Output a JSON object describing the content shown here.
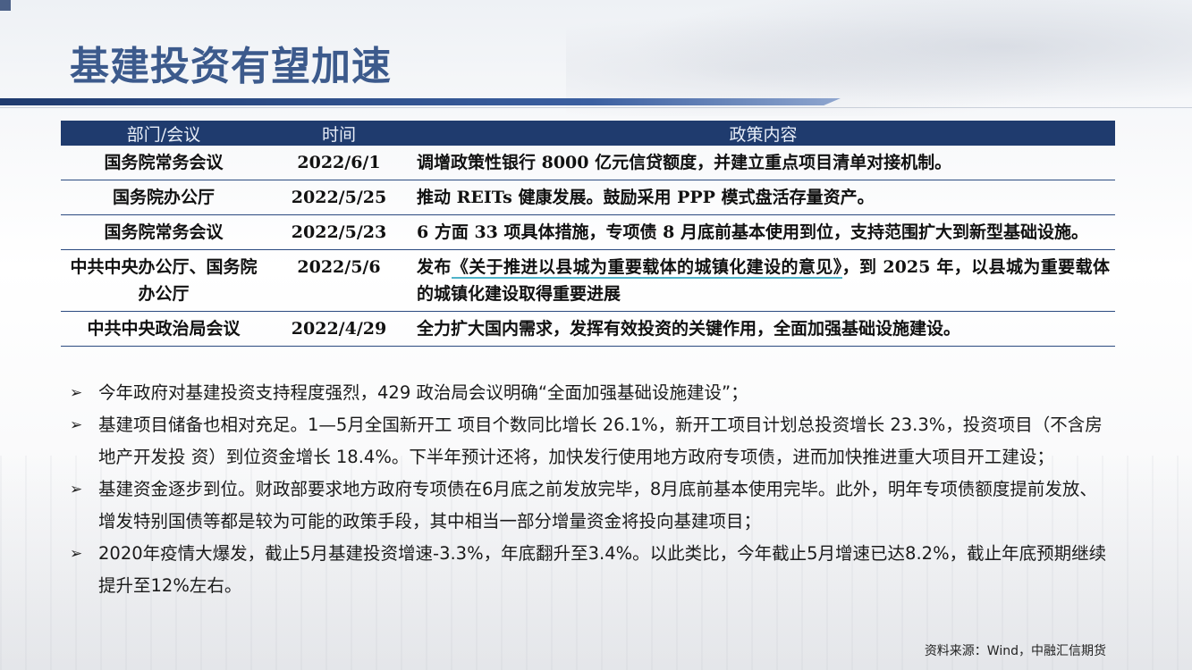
{
  "slide": {
    "title": "基建投资有望加速",
    "table": {
      "headers": [
        "部门/会议",
        "时间",
        "政策内容"
      ],
      "rows": [
        {
          "dept": "国务院常务会议",
          "date": "2022/6/1",
          "content_parts": [
            "调增政策性银行 8000 亿元信贷额度，并建立重点项目清单对接机制。"
          ]
        },
        {
          "dept": "国务院办公厅",
          "date": "2022/5/25",
          "content_parts": [
            "推动 REITs 健康发展。鼓励采用 PPP 模式盘活存量资产。"
          ]
        },
        {
          "dept": "国务院常务会议",
          "date": "2022/5/23",
          "content_parts": [
            "6 方面 33 项具体措施，专项债 8 月底前基本使用到位，支持范围扩大到新型基础设施。"
          ]
        },
        {
          "dept": "中共中央办公厅、国务院办公厅",
          "date": "2022/5/6",
          "content_parts": [
            "发布",
            "《关于推进以县城为重要载体的城镇化建设的意见》",
            "，到 2025 年，以县城为重要载体的城镇化建设取得重要进展"
          ]
        },
        {
          "dept": "中共中央政治局会议",
          "date": "2022/4/29",
          "content_parts": [
            "全力扩大国内需求，发挥有效投资的关键作用，全面加强基础设施建设。"
          ]
        }
      ]
    },
    "bullets": [
      "今年政府对基建投资支持程度强烈，429 政治局会议明确“全面加强基础设施建设”；",
      "基建项目储备也相对充足。1—5月全国新开工 项目个数同比增长 26.1%，新开工项目计划总投资增长 23.3%，投资项目（不含房地产开发投 资）到位资金增长 18.4%。下半年预计还将，加快发行使用地方政府专项债，进而加快推进重大项目开工建设；",
      "基建资金逐步到位。财政部要求地方政府专项债在6月底之前发放完毕，8月底前基本使用完毕。此外，明年专项债额度提前发放、增发特别国债等都是较为可能的政策手段，其中相当一部分增量资金将投向基建项目；",
      "2020年疫情大爆发，截止5月基建投资增速-3.3%，年底翻升至3.4%。以此类比，今年截止5月增速已达8.2%，截止年底预期继续提升至12%左右。"
    ],
    "bullet_icon": "arrow-right-icon",
    "source": "资料来源：Wind，中融汇信期货",
    "colors": {
      "title": "#3c5a8c",
      "header_bg": "#1f3b6e",
      "rule": "#1f3a6e",
      "link_underline": "#4fb3c9"
    }
  }
}
